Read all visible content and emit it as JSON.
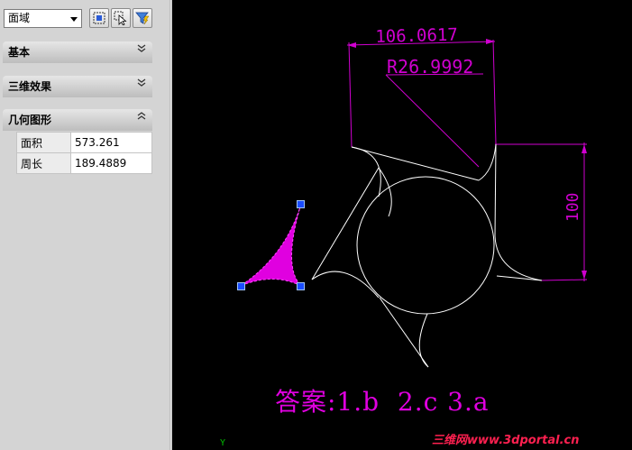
{
  "selector": {
    "value": "面域"
  },
  "toolbar": {
    "quick_select_icon": "quick-select-icon",
    "select_objects_icon": "select-objects-icon",
    "filter_icon": "filter-icon"
  },
  "sections": [
    {
      "label": "基本",
      "state": "collapsed"
    },
    {
      "label": "三维效果",
      "state": "collapsed"
    },
    {
      "label": "几何图形",
      "state": "expanded"
    }
  ],
  "geometry_props": [
    {
      "key": "面积",
      "value": "573.261"
    },
    {
      "key": "周长",
      "value": "189.4889"
    }
  ],
  "drawing": {
    "dim_top": "106.0617",
    "dim_radius": "R26.9992",
    "dim_right": "100",
    "answer": "答案:1.b  2.c 3.a",
    "watermark": "三维网www.3dportal.cn",
    "ucs_label": "Y"
  },
  "colors": {
    "dimension": "#d000d0",
    "geometry": "#ffffff",
    "selection_fill": "#e000e0",
    "grip": "#1a4cff"
  }
}
